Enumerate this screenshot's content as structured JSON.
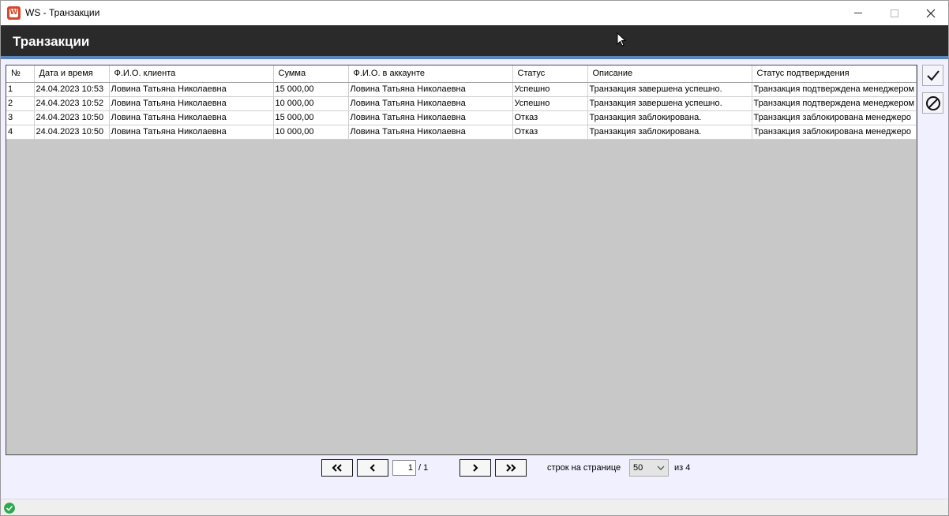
{
  "window": {
    "title": "WS - Транзакции",
    "icon": "ws-app-icon",
    "icon_letter": "W"
  },
  "header": {
    "title": "Транзакции"
  },
  "table": {
    "columns": [
      "№",
      "Дата и время",
      "Ф.И.О. клиента",
      "Сумма",
      "Ф.И.О. в аккаунте",
      "Статус",
      "Описание",
      "Статус подтверждения"
    ],
    "rows": [
      [
        "1",
        "24.04.2023 10:53",
        "Ловина Татьяна Николаевна",
        "15 000,00",
        "Ловина Татьяна Николаевна",
        "Успешно",
        "Транзакция завершена успешно.",
        "Транзакция подтверждена менеджером"
      ],
      [
        "2",
        "24.04.2023 10:52",
        "Ловина Татьяна Николаевна",
        "10 000,00",
        "Ловина Татьяна Николаевна",
        "Успешно",
        "Транзакция завершена успешно.",
        "Транзакция подтверждена менеджером"
      ],
      [
        "3",
        "24.04.2023 10:50",
        "Ловина Татьяна Николаевна",
        "15 000,00",
        "Ловина Татьяна Николаевна",
        "Отказ",
        "Транзакция заблокирована.",
        "Транзакция заблокирована менеджеро"
      ],
      [
        "4",
        "24.04.2023 10:50",
        "Ловина Татьяна Николаевна",
        "10 000,00",
        "Ловина Татьяна Николаевна",
        "Отказ",
        "Транзакция заблокирована.",
        "Транзакция заблокирована менеджеро"
      ]
    ]
  },
  "side_buttons": {
    "confirm_icon": "checkmark-icon",
    "reject_icon": "block-icon"
  },
  "pagination": {
    "current_page": "1",
    "total_pages": "/ 1",
    "rows_per_page_label": "строк на странице",
    "rows_per_page": "50",
    "total_label": "из 4"
  },
  "status": {
    "icon": "ok-status-icon",
    "color": "#2fa84f"
  },
  "colors": {
    "header_bg": "#2a2a2a",
    "accent": "#5b86bd",
    "grid_bg": "#c8c8c8"
  }
}
